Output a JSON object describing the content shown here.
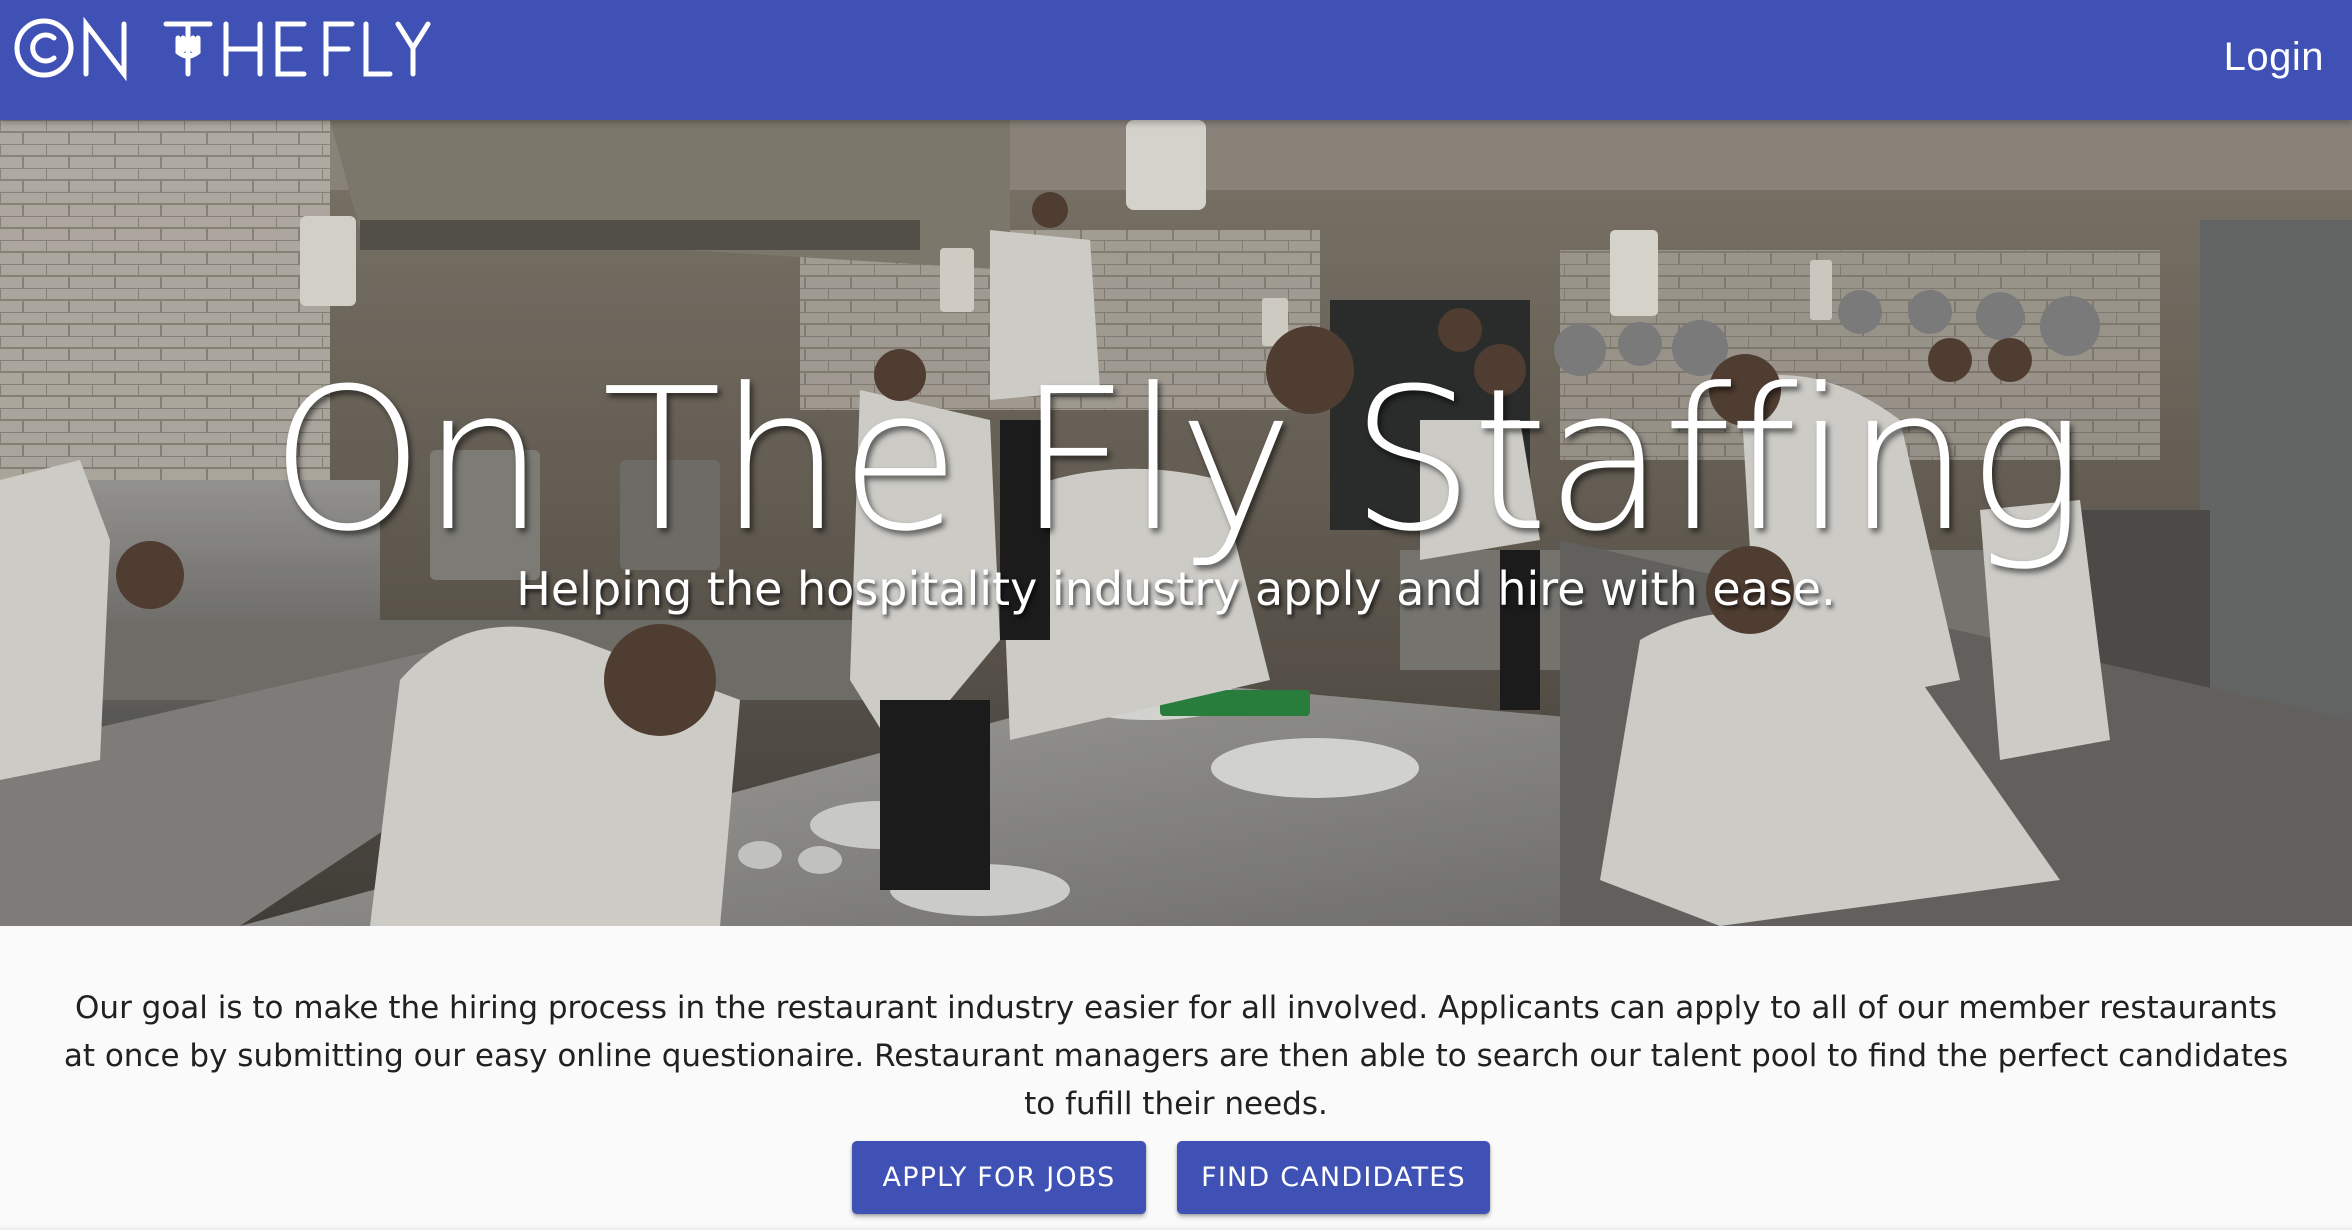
{
  "header": {
    "logo_text": "ON THE FLY",
    "login_label": "Login"
  },
  "hero": {
    "title": "On The Fly Staffing",
    "subtitle": "Helping the hospitality industry apply and hire with ease."
  },
  "intro": {
    "text": "Our goal is to make the hiring process in the restaurant industry easier for all involved. Applicants can apply to all of our member restaurants at once by submitting our easy online questionaire. Restaurant managers are then able to search our talent pool to find the perfect candidates to fufill their needs."
  },
  "actions": {
    "apply_label": "APPLY FOR JOBS",
    "find_label": "FIND CANDIDATES"
  },
  "colors": {
    "primary": "#3f51b5",
    "background": "#fafafa",
    "text": "#212121"
  },
  "icons": {
    "logo": "on-the-fly-logo-with-fork"
  }
}
